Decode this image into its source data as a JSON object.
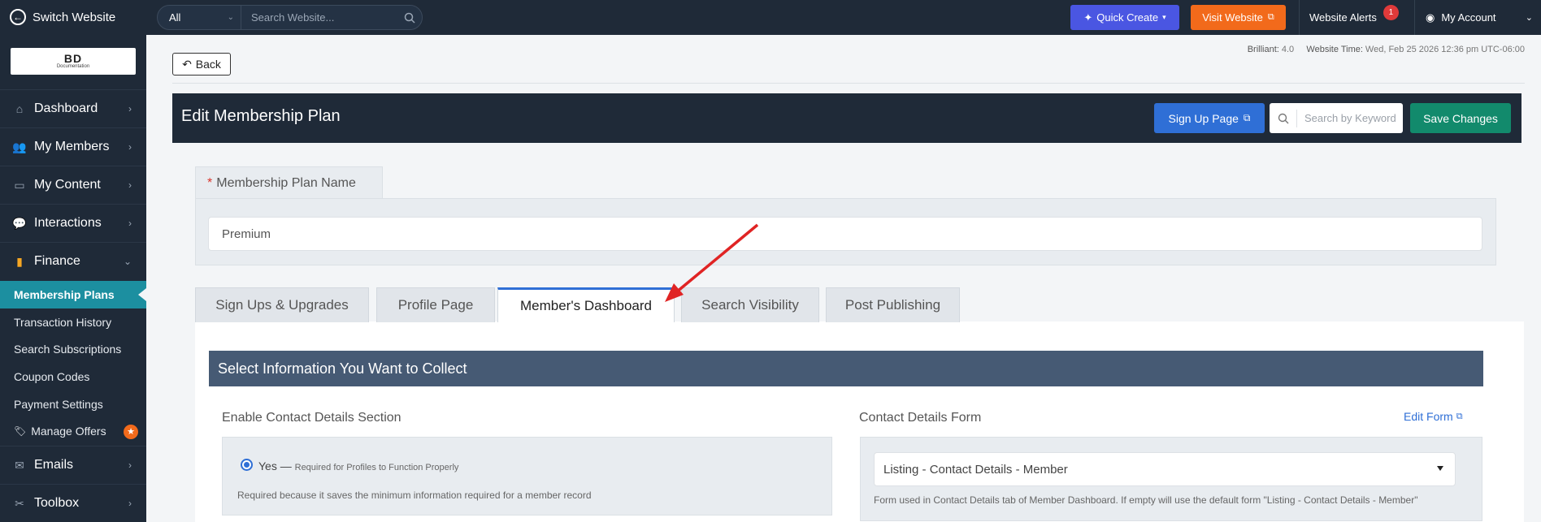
{
  "topbar": {
    "switch_label": "Switch Website",
    "search_scope": "All",
    "search_placeholder": "Search Website...",
    "quick_create": "Quick Create",
    "visit_website": "Visit Website",
    "alerts_label": "Website Alerts",
    "alerts_count": "1",
    "account_label": "My Account"
  },
  "sidebar": {
    "logo_main": "BD",
    "logo_sub": "Documentation",
    "items": [
      {
        "label": "Dashboard"
      },
      {
        "label": "My Members"
      },
      {
        "label": "My Content"
      },
      {
        "label": "Interactions"
      },
      {
        "label": "Finance"
      },
      {
        "label": "Emails"
      },
      {
        "label": "Toolbox"
      }
    ],
    "finance_sub": [
      {
        "label": "Membership Plans"
      },
      {
        "label": "Transaction History"
      },
      {
        "label": "Search Subscriptions"
      },
      {
        "label": "Coupon Codes"
      },
      {
        "label": "Payment Settings"
      },
      {
        "label": "Manage Offers"
      }
    ]
  },
  "header": {
    "back_label": "Back",
    "brilliant_label": "Brilliant:",
    "brilliant_value": "4.0",
    "time_label": "Website Time:",
    "time_value": "Wed, Feb 25 2026 12:36 pm UTC-06:00"
  },
  "panel": {
    "title": "Edit Membership Plan",
    "signup_page": "Sign Up Page",
    "keyword_placeholder": "Search by Keyword",
    "save_changes": "Save Changes"
  },
  "plan_name": {
    "required_mark": "*",
    "label": "Membership Plan Name",
    "value": "Premium"
  },
  "tabs": [
    {
      "label": "Sign Ups & Upgrades"
    },
    {
      "label": "Profile Page"
    },
    {
      "label": "Member's Dashboard"
    },
    {
      "label": "Search Visibility"
    },
    {
      "label": "Post Publishing"
    }
  ],
  "section": {
    "title": "Select Information You Want to Collect",
    "enable_label": "Enable Contact Details Section",
    "radio_yes": "Yes —",
    "radio_note": "Required for Profiles to Function Properly",
    "radio_help": "Required because it saves the minimum information required for a member record",
    "form_label": "Contact Details Form",
    "edit_form": "Edit Form",
    "form_selected": "Listing - Contact Details - Member",
    "form_help": "Form used in Contact Details tab of Member Dashboard. If empty will use the default form \"Listing - Contact Details - Member\""
  },
  "colors": {
    "sidebar_bg": "#1f2a38",
    "active_item": "#1c8fa0",
    "quick_create": "#4a56e2",
    "visit_website": "#f26a1b",
    "save": "#128a6c",
    "signup": "#2f6fd6",
    "annotation_arrow": "#e02424"
  }
}
